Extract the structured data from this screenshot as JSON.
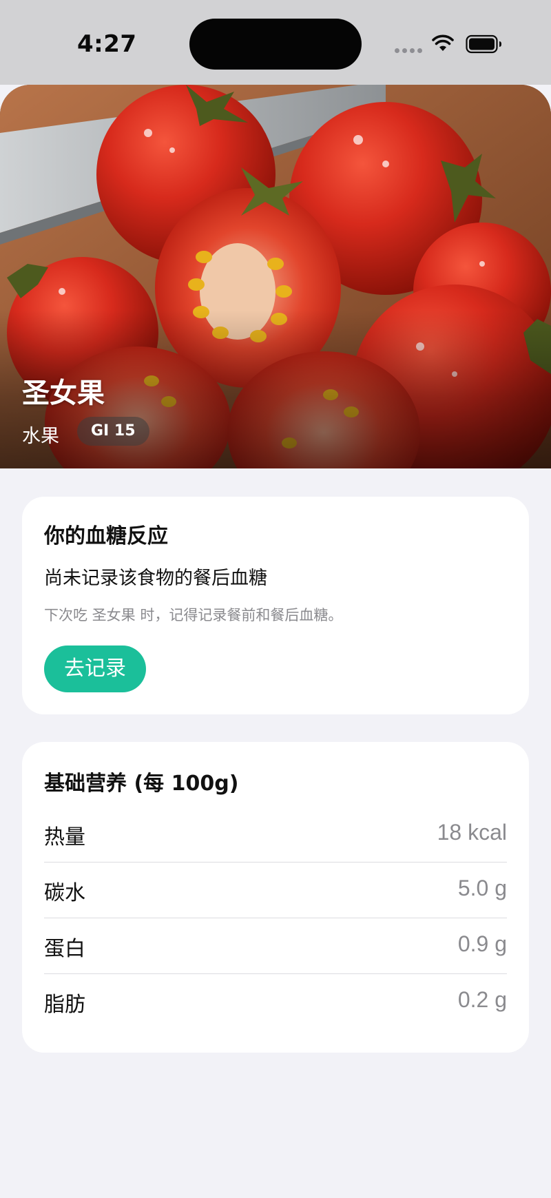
{
  "status_bar": {
    "time": "4:27",
    "wifi_icon": "wifi-icon",
    "battery_icon": "battery-full-icon"
  },
  "food": {
    "name": "圣女果",
    "category": "水果",
    "gi": "GI 15",
    "photo": "cherry-tomatoes-photo"
  },
  "glucose_card": {
    "title": "你的血糖反应",
    "message": "尚未记录该食物的餐后血糖",
    "hint": "下次吃 圣女果 时，记得记录餐前和餐后血糖。",
    "button": "去记录"
  },
  "nutrition_card": {
    "title": "基础营养 (每 100g)",
    "rows": [
      {
        "label": "热量",
        "value": "18 kcal"
      },
      {
        "label": "碳水",
        "value": "5.0 g"
      },
      {
        "label": "蛋白",
        "value": "0.9 g"
      },
      {
        "label": "脂肪",
        "value": "0.2 g"
      }
    ]
  },
  "colors": {
    "accent": "#1bbf9a",
    "page_background": "#f2f2f7",
    "card_background": "#ffffff",
    "secondary_text": "#8a8a8e"
  }
}
